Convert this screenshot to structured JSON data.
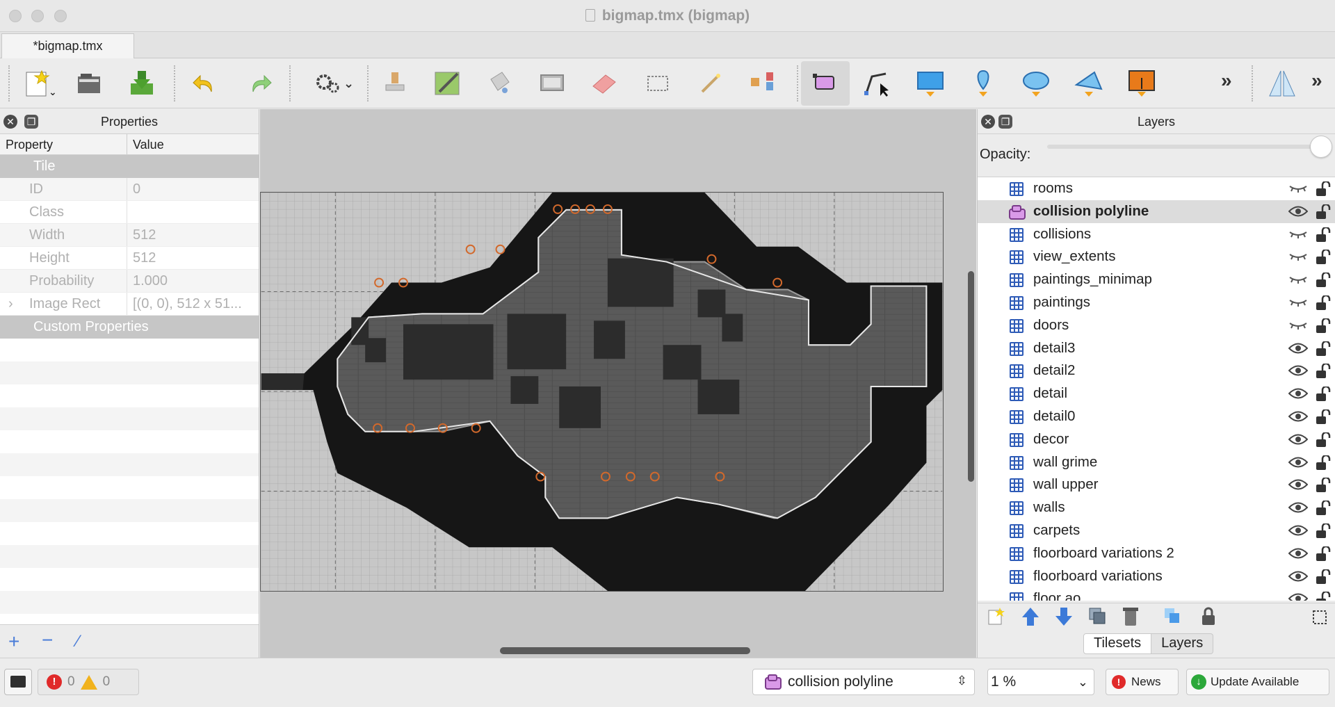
{
  "window": {
    "title": "bigmap.tmx (bigmap)"
  },
  "tabs": [
    {
      "label": "*bigmap.tmx"
    }
  ],
  "toolbar": {
    "tools": [
      "new-document-icon",
      "open-folder-icon",
      "save-icon",
      "undo-icon",
      "redo-icon",
      "commands-gear-icon",
      "stamp-brush-icon",
      "terrain-brush-icon",
      "bucket-fill-icon",
      "shape-fill-icon",
      "eraser-icon",
      "rect-select-icon",
      "magic-wand-icon",
      "select-same-tile-icon",
      "select-objects-icon",
      "edit-polygons-icon",
      "insert-rectangle-icon",
      "insert-point-icon",
      "insert-ellipse-icon",
      "insert-polygon-icon",
      "insert-tile-icon",
      "flip-icon"
    ],
    "active_tool": "select-objects-icon"
  },
  "properties_panel": {
    "title": "Properties",
    "columns": {
      "property": "Property",
      "value": "Value"
    },
    "group_tile": "Tile",
    "rows": [
      {
        "name": "ID",
        "value": "0"
      },
      {
        "name": "Class",
        "value": ""
      },
      {
        "name": "Width",
        "value": "512"
      },
      {
        "name": "Height",
        "value": "512"
      },
      {
        "name": "Probability",
        "value": "1.000"
      },
      {
        "name": "Image Rect",
        "value": "[(0, 0), 512 x 51..."
      }
    ],
    "expander_glyph": "›",
    "group_custom": "Custom Properties"
  },
  "layers_panel": {
    "title": "Layers",
    "opacity_label": "Opacity:",
    "opacity": 1.0,
    "selected_layer": "collision polyline",
    "layers": [
      {
        "name": "rooms",
        "type": "tile",
        "visible": false
      },
      {
        "name": "collision polyline",
        "type": "object",
        "visible": true
      },
      {
        "name": "collisions",
        "type": "tile",
        "visible": false
      },
      {
        "name": "view_extents",
        "type": "tile",
        "visible": false
      },
      {
        "name": "paintings_minimap",
        "type": "tile",
        "visible": false
      },
      {
        "name": "paintings",
        "type": "tile",
        "visible": false
      },
      {
        "name": "doors",
        "type": "tile",
        "visible": false
      },
      {
        "name": "detail3",
        "type": "tile",
        "visible": true
      },
      {
        "name": "detail2",
        "type": "tile",
        "visible": true
      },
      {
        "name": "detail",
        "type": "tile",
        "visible": true
      },
      {
        "name": "detail0",
        "type": "tile",
        "visible": true
      },
      {
        "name": "decor",
        "type": "tile",
        "visible": true
      },
      {
        "name": "wall grime",
        "type": "tile",
        "visible": true
      },
      {
        "name": "wall upper",
        "type": "tile",
        "visible": true
      },
      {
        "name": "walls",
        "type": "tile",
        "visible": true
      },
      {
        "name": "carpets",
        "type": "tile",
        "visible": true
      },
      {
        "name": "floorboard variations 2",
        "type": "tile",
        "visible": true
      },
      {
        "name": "floorboard variations",
        "type": "tile",
        "visible": true
      },
      {
        "name": "floor ao",
        "type": "tile",
        "visible": true
      }
    ],
    "bottom_tabs": [
      "Tilesets",
      "Layers"
    ]
  },
  "statusbar": {
    "errors": "0",
    "warnings": "0",
    "current_layer": "collision polyline",
    "zoom": "1 %",
    "news_label": "News",
    "update_label": "Update Available"
  },
  "colors": {
    "accent_blue": "#2e5bb7",
    "selection": "#dcdcdc",
    "object_layer": "#b35bd0"
  }
}
